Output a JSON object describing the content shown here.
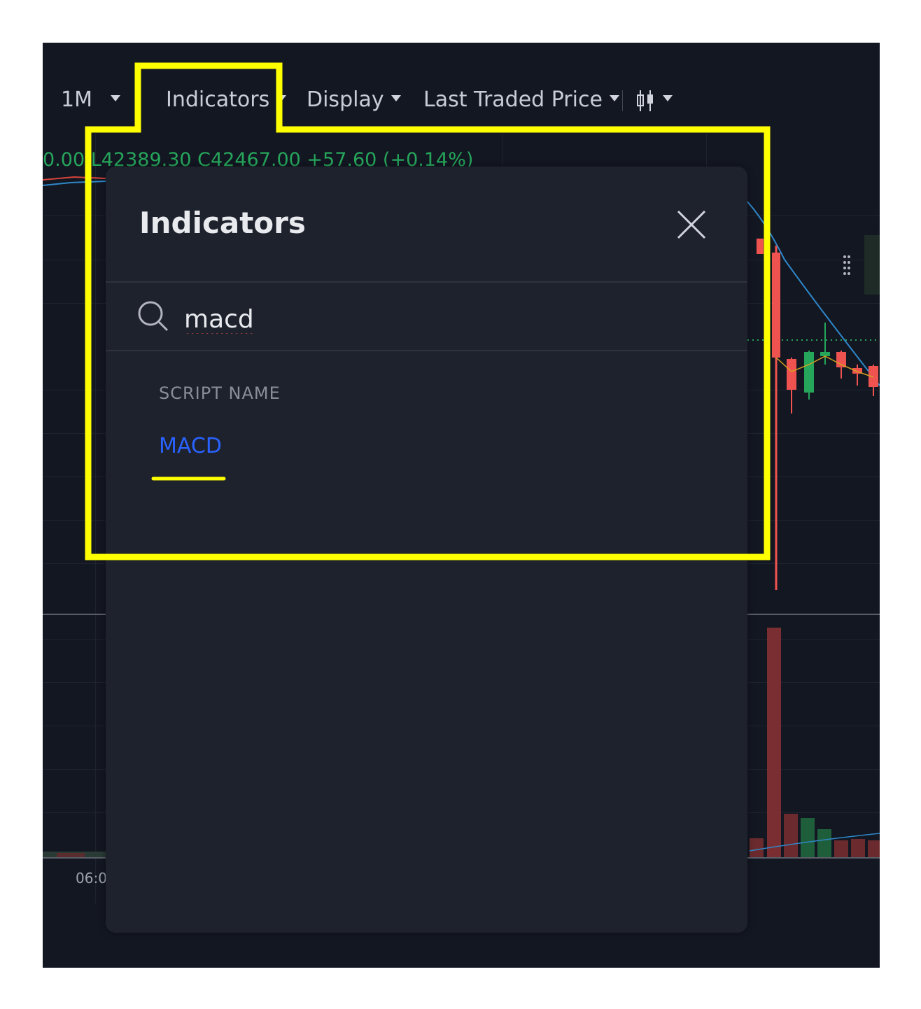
{
  "toolbar": {
    "interval": "1M",
    "indicators": "Indicators",
    "display": "Display",
    "price_source": "Last Traded Price"
  },
  "chart_header": {
    "ohlc": "0.00  L42389.30  C42467.00  +57.60 (+0.14%)"
  },
  "time_axis": {
    "label": "06:0"
  },
  "indicators_dialog": {
    "title": "Indicators",
    "search": {
      "value": "macd"
    },
    "section_label": "SCRIPT NAME",
    "results": [
      "MACD"
    ]
  },
  "colors": {
    "background": "#131722",
    "panel": "#1e222d",
    "accent_blue": "#2962ff",
    "candle_up": "#26a65b",
    "candle_down": "#ef5350",
    "highlight": "#ffff00"
  }
}
